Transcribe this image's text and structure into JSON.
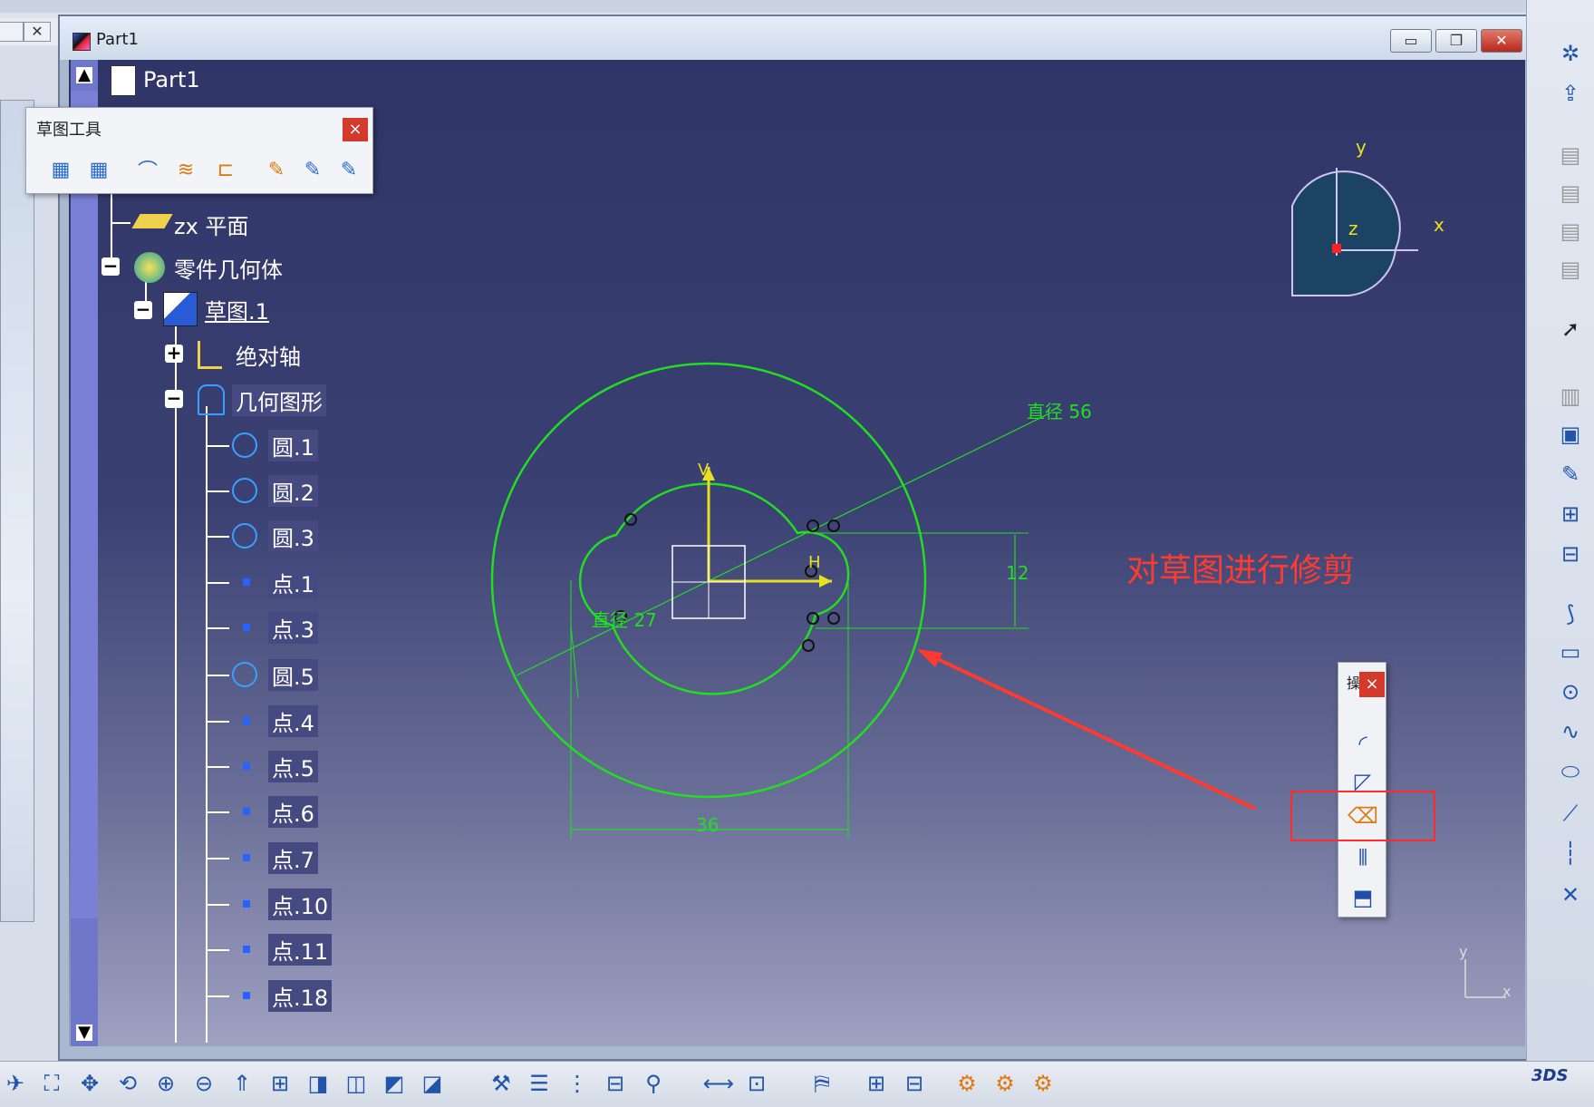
{
  "window": {
    "title": "Part1",
    "min_label": "▭",
    "max_label": "❐",
    "close_label": "✕"
  },
  "background_window": {
    "close_label": "✕"
  },
  "tree": {
    "root": "Part1",
    "items": [
      {
        "label": "zx 平面",
        "icon": "plane-icon"
      },
      {
        "label": "零件几何体",
        "icon": "body-icon"
      },
      {
        "label": "草图.1",
        "icon": "sketch-icon"
      },
      {
        "label": "绝对轴",
        "icon": "axis-icon"
      },
      {
        "label": "几何图形",
        "icon": "geometry-icon"
      },
      {
        "label": "圆.1",
        "icon": "circle-icon"
      },
      {
        "label": "圆.2",
        "icon": "circle-icon"
      },
      {
        "label": "圆.3",
        "icon": "circle-icon"
      },
      {
        "label": "点.1",
        "icon": "point-icon"
      },
      {
        "label": "点.3",
        "icon": "point-icon"
      },
      {
        "label": "圆.5",
        "icon": "circle-icon"
      },
      {
        "label": "点.4",
        "icon": "point-icon"
      },
      {
        "label": "点.5",
        "icon": "point-icon"
      },
      {
        "label": "点.6",
        "icon": "point-icon"
      },
      {
        "label": "点.7",
        "icon": "point-icon"
      },
      {
        "label": "点.10",
        "icon": "point-icon"
      },
      {
        "label": "点.11",
        "icon": "point-icon"
      },
      {
        "label": "点.18",
        "icon": "point-icon"
      }
    ]
  },
  "sketch_tools": {
    "title": "草图工具",
    "close_label": "×"
  },
  "trim_tools": {
    "title": "操",
    "close_label": "×"
  },
  "sketch": {
    "dim_outer": "直径 56",
    "dim_inner": "直径 27",
    "dim_height": "12",
    "dim_width": "36",
    "h_label": "H",
    "v_label": "V"
  },
  "compass": {
    "x": "x",
    "y": "y",
    "z": "z"
  },
  "axis_corner": {
    "x": "x",
    "y": "y"
  },
  "annotation": "对草图进行修剪",
  "colors": {
    "sketch": "#22dd22",
    "axis": "#e8e020",
    "annotation": "#ff3b2f",
    "tree_bg": "#454a80"
  }
}
